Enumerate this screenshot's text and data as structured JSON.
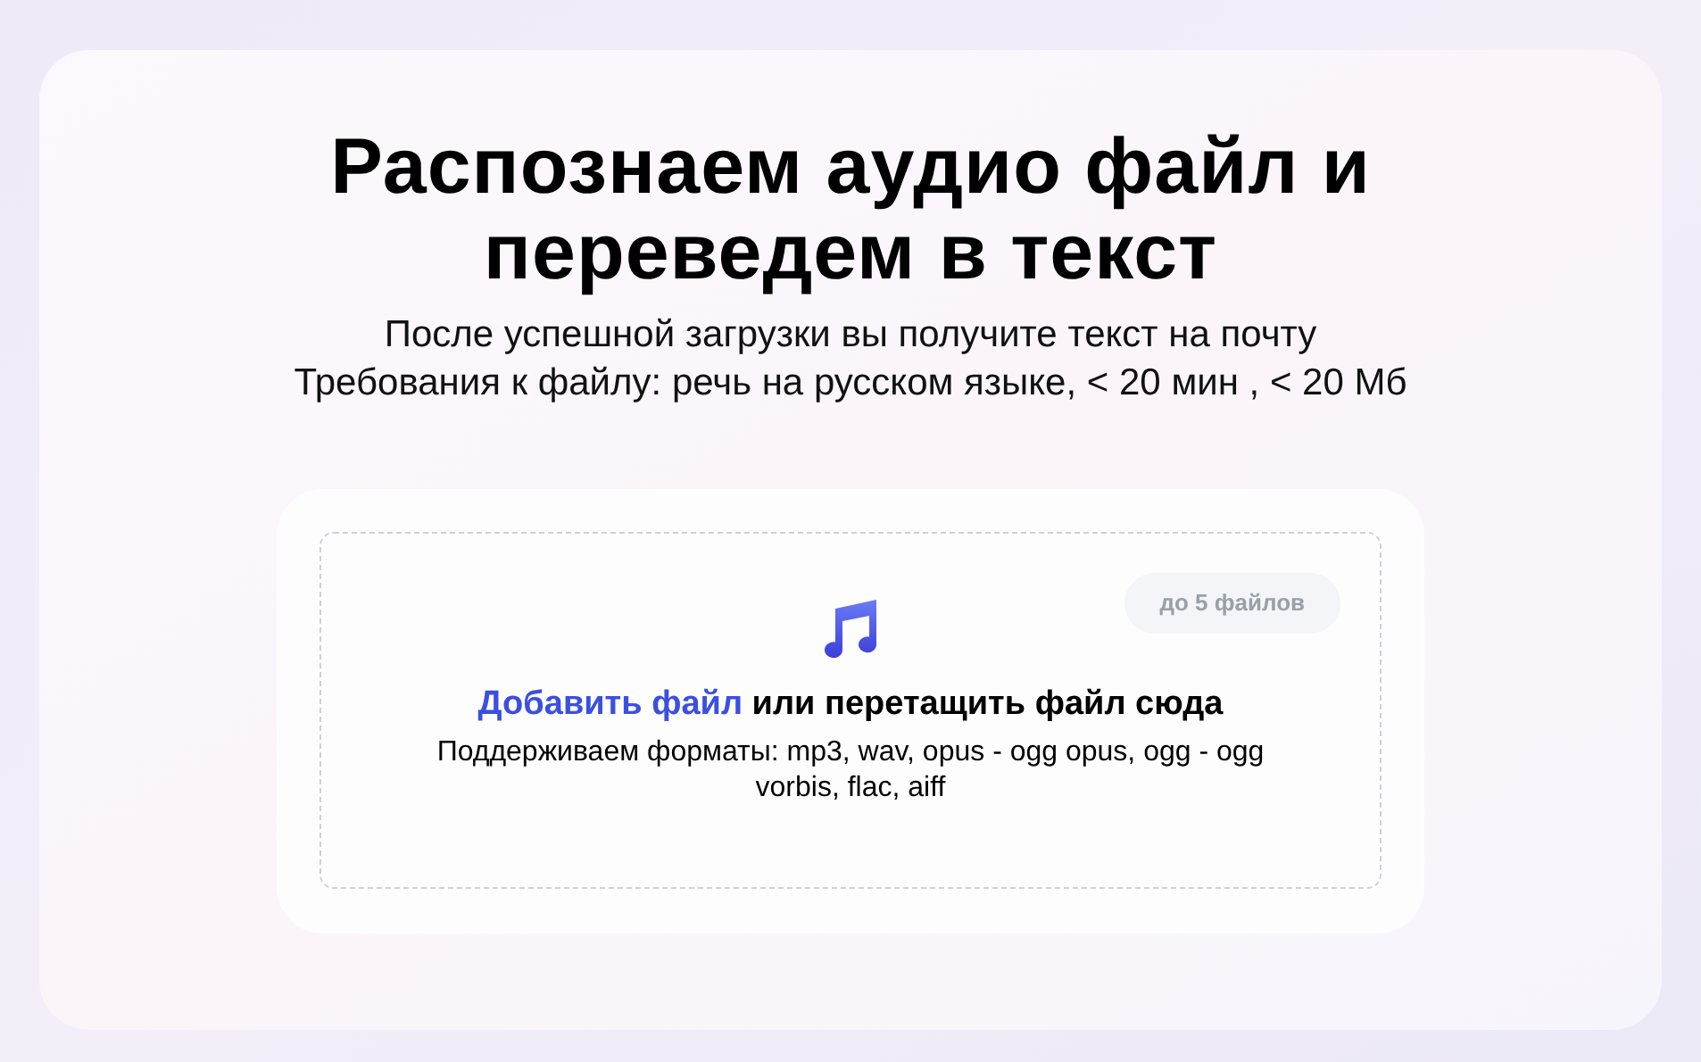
{
  "title": "Распознаем аудио файл и переведем в текст",
  "subtitle_lines": [
    "После успешной загрузки вы получите текст на почту",
    "Требования к файлу: речь на русском языке, < 20 мин , < 20 Мб"
  ],
  "upload": {
    "badge": "до 5 файлов",
    "link": "Добавить файл",
    "prompt": " или перетащить файл сюда",
    "formats": "Поддерживаем форматы: mp3, wav, opus - ogg opus, ogg - ogg vorbis, flac, aiff"
  }
}
